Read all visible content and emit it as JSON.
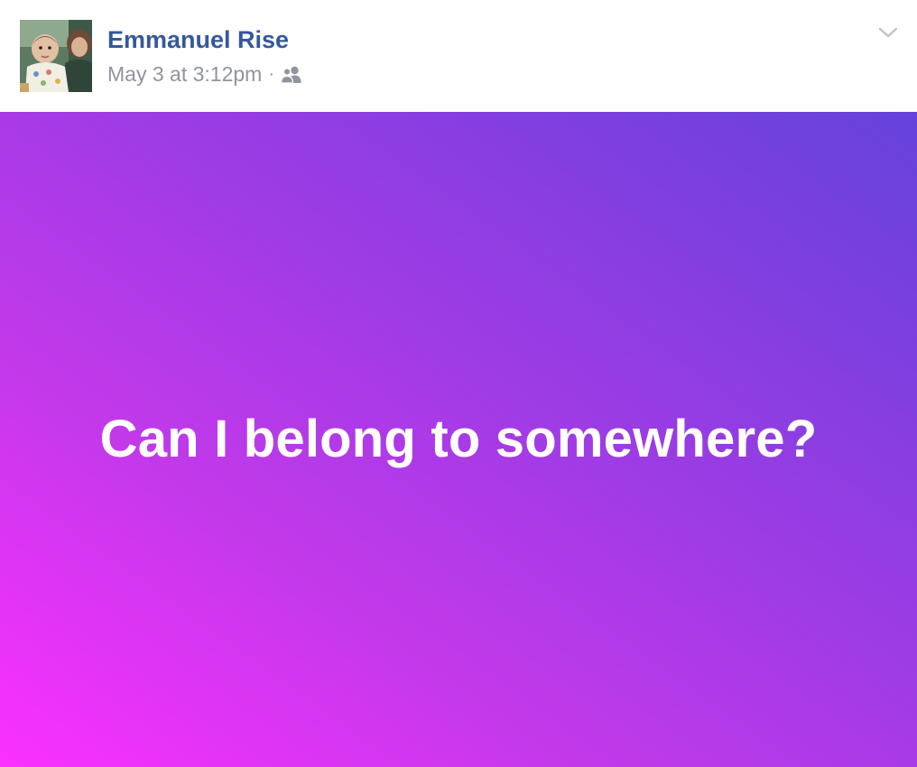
{
  "post": {
    "author": {
      "name": "Emmanuel Rise",
      "avatar_icon": "profile-photo"
    },
    "meta": {
      "timestamp": "May 3 at 3:12pm",
      "separator": "·",
      "audience_icon": "friends-icon"
    },
    "options_icon": "chevron-down-icon",
    "status": {
      "text": "Can I belong to somewhere?",
      "background_gradient": [
        "#fb30ff",
        "#c239ea",
        "#9a3ce4",
        "#6542db"
      ],
      "text_color": "#ffffff"
    }
  },
  "colors": {
    "author_name": "#365899",
    "meta_text": "#90949c",
    "header_background": "#ffffff"
  }
}
